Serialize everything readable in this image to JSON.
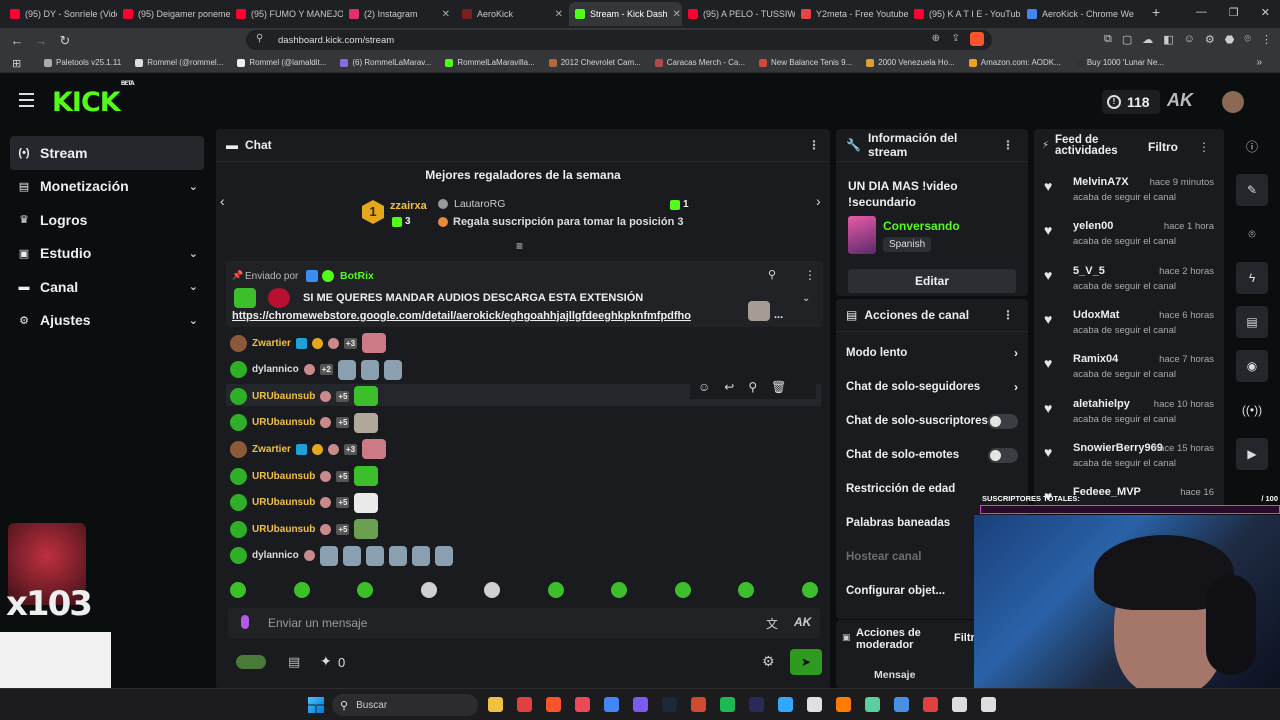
{
  "browser": {
    "tabs": [
      {
        "label": "(95) DY - Sonríele (Vide",
        "color": "#ff0033"
      },
      {
        "label": "(95) Deigamer poneme",
        "color": "#ff0033"
      },
      {
        "label": "(95) FUMO Y MANEJO",
        "color": "#ff0033"
      },
      {
        "label": "(2) Instagram",
        "color": "#e1306c"
      },
      {
        "label": "AeroKick",
        "color": "#7a1f1f"
      },
      {
        "label": "Stream - Kick Dash",
        "color": "#53fc18"
      },
      {
        "label": "(95) A PELO - TUSSIWA",
        "color": "#ff0033"
      },
      {
        "label": "Y2meta - Free Youtube",
        "color": "#e64545"
      },
      {
        "label": "(95) K A T I E - YouTub",
        "color": "#ff0033"
      },
      {
        "label": "AeroKick - Chrome We",
        "color": "#4285f4"
      }
    ],
    "new_tab": "+",
    "url": "dashboard.kick.com/stream",
    "bookmarks": [
      "Paletools v25.1.11",
      "Rommel (@rommel...",
      "Rommel (@lamaldit...",
      "(6) RommelLaMarav...",
      "RommelLaMaravilla...",
      "2012 Chevrolet Cam...",
      "Caracas Merch - Ca...",
      "New Balance Tenis 9...",
      "2000 Venezuela Ho...",
      "Amazon.com: AODK...",
      "Buy 1000 'Lunar Ne..."
    ]
  },
  "header": {
    "logo": "KICK",
    "beta": "BETA",
    "viewers": "118"
  },
  "sidebar": {
    "items": [
      {
        "label": "Stream",
        "icon": "broadcast-icon",
        "glyph": "(•)",
        "chev": ""
      },
      {
        "label": "Monetización",
        "icon": "wallet-icon",
        "glyph": "▤",
        "chev": "⌄"
      },
      {
        "label": "Logros",
        "icon": "trophy-icon",
        "glyph": "♛",
        "chev": ""
      },
      {
        "label": "Estudio",
        "icon": "studio-icon",
        "glyph": "▣",
        "chev": "⌄"
      },
      {
        "label": "Canal",
        "icon": "channel-icon",
        "glyph": "▬",
        "chev": "⌄"
      },
      {
        "label": "Ajustes",
        "icon": "gear-icon",
        "glyph": "⚙",
        "chev": "⌄"
      }
    ]
  },
  "chat": {
    "title": "Chat",
    "top_gifters_title": "Mejores regaladores de la semana",
    "gifter1": {
      "rank": "1",
      "name": "zzairxa",
      "count": "3"
    },
    "gifter2": {
      "name": "LautaroRG",
      "count": "1"
    },
    "gift_cta": "Regala suscripción para tomar la posición 3",
    "pinned": {
      "sent_by": "Enviado por",
      "bot": "BotRix",
      "message": "SI ME QUERES MANDAR AUDIOS DESCARGA ESTA EXTENSIÓN",
      "link": "https://chromewebstore.google.com/detail/aerokick/eghgoahhjajllgfdeeghkpknfmfpdfho",
      "more": "..."
    },
    "messages": [
      {
        "user": "Zwartier",
        "color": "#f0c040",
        "badge": "+3"
      },
      {
        "user": "dylannico",
        "color": "#dddddd",
        "badge": "+2"
      },
      {
        "user": "URUbaunsub",
        "color": "#f0c040",
        "badge": "+5"
      },
      {
        "user": "URUbaunsub",
        "color": "#f0c040",
        "badge": "+5"
      },
      {
        "user": "Zwartier",
        "color": "#f0c040",
        "badge": "+3"
      },
      {
        "user": "URUbaunsub",
        "color": "#f0c040",
        "badge": "+5"
      },
      {
        "user": "URUbaunsub",
        "color": "#f0c040",
        "badge": "+5"
      },
      {
        "user": "URUbaunsub",
        "color": "#f0c040",
        "badge": "+5"
      },
      {
        "user": "dylannico",
        "color": "#dddddd",
        "badge": ""
      }
    ],
    "input_placeholder": "Enviar un mensaje",
    "points": "0"
  },
  "stream_info": {
    "title": "Información del stream",
    "stream_title": "UN DIA MAS !video !secundario",
    "category": "Conversando",
    "language": "Spanish",
    "edit_label": "Editar"
  },
  "channel_actions": {
    "title": "Acciones de canal",
    "items": [
      {
        "label": "Modo lento",
        "type": "arrow"
      },
      {
        "label": "Chat de solo-seguidores",
        "type": "arrow"
      },
      {
        "label": "Chat de solo-suscriptores",
        "type": "toggle"
      },
      {
        "label": "Chat de solo-emotes",
        "type": "toggle"
      },
      {
        "label": "Restricción de edad",
        "type": "none"
      },
      {
        "label": "Palabras baneadas",
        "type": "none"
      },
      {
        "label": "Hostear canal",
        "type": "disabled"
      },
      {
        "label": "Configurar objet...",
        "type": "none"
      }
    ],
    "moderator_title": "Acciones de moderador",
    "moderator_filter": "Filtro",
    "moderator_item": "Mensaje"
  },
  "feed": {
    "title": "Feed de actividades",
    "filter": "Filtro",
    "items": [
      {
        "name": "MelvinA7X",
        "time": "hace 9 minutos",
        "action": "acaba de seguir el canal"
      },
      {
        "name": "yelen00",
        "time": "hace 1 hora",
        "action": "acaba de seguir el canal"
      },
      {
        "name": "5_V_5",
        "time": "hace 2 horas",
        "action": "acaba de seguir el canal"
      },
      {
        "name": "UdoxMat",
        "time": "hace 6 horas",
        "action": "acaba de seguir el canal"
      },
      {
        "name": "Ramix04",
        "time": "hace 7 horas",
        "action": "acaba de seguir el canal"
      },
      {
        "name": "aletahielpy",
        "time": "hace 10 horas",
        "action": "acaba de seguir el canal"
      },
      {
        "name": "SnowierBerry969",
        "time": "hace 15 horas",
        "action": "acaba de seguir el canal"
      },
      {
        "name": "Fedeee_MVP",
        "time": "hace 16",
        "action": ""
      }
    ]
  },
  "overlay": {
    "subs_label": "SUSCRIPTORES TOTALES:",
    "subs_value": "/ 100",
    "multiplier": "x103"
  },
  "taskbar": {
    "search": "Buscar"
  }
}
